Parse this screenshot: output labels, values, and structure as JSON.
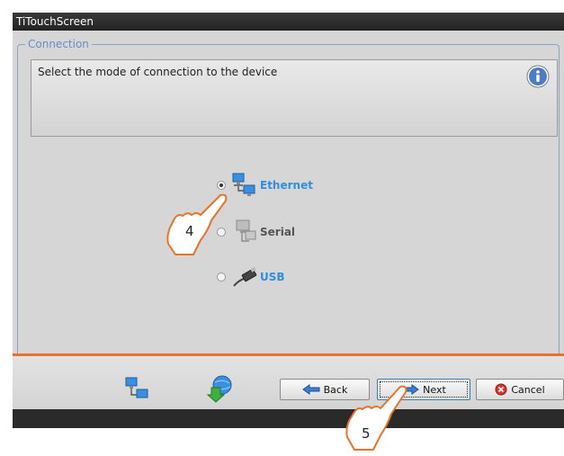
{
  "window": {
    "title": "TiTouchScreen"
  },
  "connection_group": {
    "legend": "Connection",
    "info_text": "Select the mode of connection to the device"
  },
  "options": [
    {
      "label": "Ethernet",
      "selected": true,
      "icon": "network-computers-icon"
    },
    {
      "label": "Serial",
      "selected": false,
      "icon": "serial-port-icon"
    },
    {
      "label": "USB",
      "selected": false,
      "icon": "usb-cable-icon"
    }
  ],
  "buttons": {
    "back": "Back",
    "next": "Next",
    "cancel": "Cancel"
  },
  "callouts": {
    "step_a": "4",
    "step_b": "5"
  },
  "colors": {
    "accent_orange": "#e8742c",
    "active_blue": "#2f8ee0",
    "group_border": "#8aa3c7"
  }
}
